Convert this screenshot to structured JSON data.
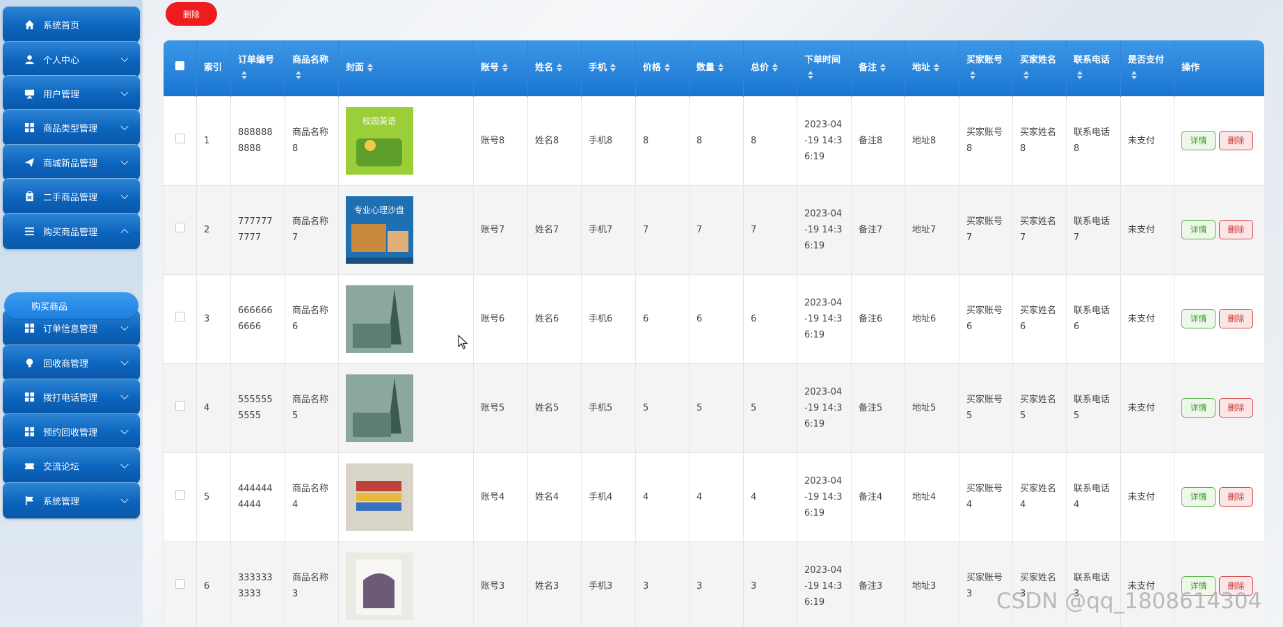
{
  "sidebar": {
    "items": [
      {
        "label": "系统首页",
        "icon": "home-icon",
        "expanded": false
      },
      {
        "label": "个人中心",
        "icon": "user-icon",
        "expanded": false
      },
      {
        "label": "用户管理",
        "icon": "monitor-icon",
        "expanded": false
      },
      {
        "label": "商品类型管理",
        "icon": "grid-icon",
        "expanded": false
      },
      {
        "label": "商城新品管理",
        "icon": "send-icon",
        "expanded": false
      },
      {
        "label": "二手商品管理",
        "icon": "clipboard-icon",
        "expanded": false
      },
      {
        "label": "购买商品管理",
        "icon": "list-icon",
        "expanded": true
      },
      {
        "label": "订单信息管理",
        "icon": "grid-icon",
        "expanded": false
      },
      {
        "label": "回收商管理",
        "icon": "bulb-icon",
        "expanded": false
      },
      {
        "label": "拨打电话管理",
        "icon": "grid-icon",
        "expanded": false
      },
      {
        "label": "预约回收管理",
        "icon": "grid-icon",
        "expanded": false
      },
      {
        "label": "交流论坛",
        "icon": "ticket-icon",
        "expanded": false
      },
      {
        "label": "系统管理",
        "icon": "flag-icon",
        "expanded": false
      }
    ],
    "submenu": {
      "label": "购买商品"
    }
  },
  "toolbar": {
    "delete_label": "删除"
  },
  "table": {
    "columns": [
      "索引",
      "订单编号",
      "商品名称",
      "封面",
      "账号",
      "姓名",
      "手机",
      "价格",
      "数量",
      "总价",
      "下单时间",
      "备注",
      "地址",
      "买家账号",
      "买家姓名",
      "联系电话",
      "是否支付",
      "操作"
    ],
    "rows": [
      {
        "index": "1",
        "order_no": "8888888888",
        "product": "商品名称8",
        "account": "账号8",
        "name": "姓名8",
        "phone": "手机8",
        "price": "8",
        "qty": "8",
        "total": "8",
        "time": "2023-04-19 14:36:19",
        "note": "备注8",
        "address": "地址8",
        "buyer_account": "买家账号8",
        "buyer_name": "买家姓名8",
        "contact": "联系电话8",
        "paid": "未支付"
      },
      {
        "index": "2",
        "order_no": "7777777777",
        "product": "商品名称7",
        "account": "账号7",
        "name": "姓名7",
        "phone": "手机7",
        "price": "7",
        "qty": "7",
        "total": "7",
        "time": "2023-04-19 14:36:19",
        "note": "备注7",
        "address": "地址7",
        "buyer_account": "买家账号7",
        "buyer_name": "买家姓名7",
        "contact": "联系电话7",
        "paid": "未支付"
      },
      {
        "index": "3",
        "order_no": "6666666666",
        "product": "商品名称6",
        "account": "账号6",
        "name": "姓名6",
        "phone": "手机6",
        "price": "6",
        "qty": "6",
        "total": "6",
        "time": "2023-04-19 14:36:19",
        "note": "备注6",
        "address": "地址6",
        "buyer_account": "买家账号6",
        "buyer_name": "买家姓名6",
        "contact": "联系电话6",
        "paid": "未支付"
      },
      {
        "index": "4",
        "order_no": "5555555555",
        "product": "商品名称5",
        "account": "账号5",
        "name": "姓名5",
        "phone": "手机5",
        "price": "5",
        "qty": "5",
        "total": "5",
        "time": "2023-04-19 14:36:19",
        "note": "备注5",
        "address": "地址5",
        "buyer_account": "买家账号5",
        "buyer_name": "买家姓名5",
        "contact": "联系电话5",
        "paid": "未支付"
      },
      {
        "index": "5",
        "order_no": "4444444444",
        "product": "商品名称4",
        "account": "账号4",
        "name": "姓名4",
        "phone": "手机4",
        "price": "4",
        "qty": "4",
        "total": "4",
        "time": "2023-04-19 14:36:19",
        "note": "备注4",
        "address": "地址4",
        "buyer_account": "买家账号4",
        "buyer_name": "买家姓名4",
        "contact": "联系电话4",
        "paid": "未支付"
      },
      {
        "index": "6",
        "order_no": "3333333333",
        "product": "商品名称3",
        "account": "账号3",
        "name": "姓名3",
        "phone": "手机3",
        "price": "3",
        "qty": "3",
        "total": "3",
        "time": "2023-04-19 14:36:19",
        "note": "备注3",
        "address": "地址3",
        "buyer_account": "买家账号3",
        "buyer_name": "买家姓名3",
        "contact": "联系电话3",
        "paid": "未支付"
      }
    ],
    "detail_label": "详情",
    "delete_label": "删除"
  },
  "covers": [
    {
      "title": "校园英语",
      "color_a": "#9bcf3a",
      "color_b": "#5e9e2a"
    },
    {
      "title": "专业心理沙盘",
      "color_a": "#1f6fb3",
      "color_b": "#c98a3e"
    },
    {
      "title": "",
      "color_a": "#8aa89c",
      "color_b": "#3c5a4f"
    },
    {
      "title": "",
      "color_a": "#8aa89c",
      "color_b": "#3c5a4f"
    },
    {
      "title": "",
      "color_a": "#d9d4c8",
      "color_b": "#c0413a"
    },
    {
      "title": "",
      "color_a": "#eceae4",
      "color_b": "#6b5a78"
    }
  ],
  "watermark": "CSDN @qq_1808614304"
}
